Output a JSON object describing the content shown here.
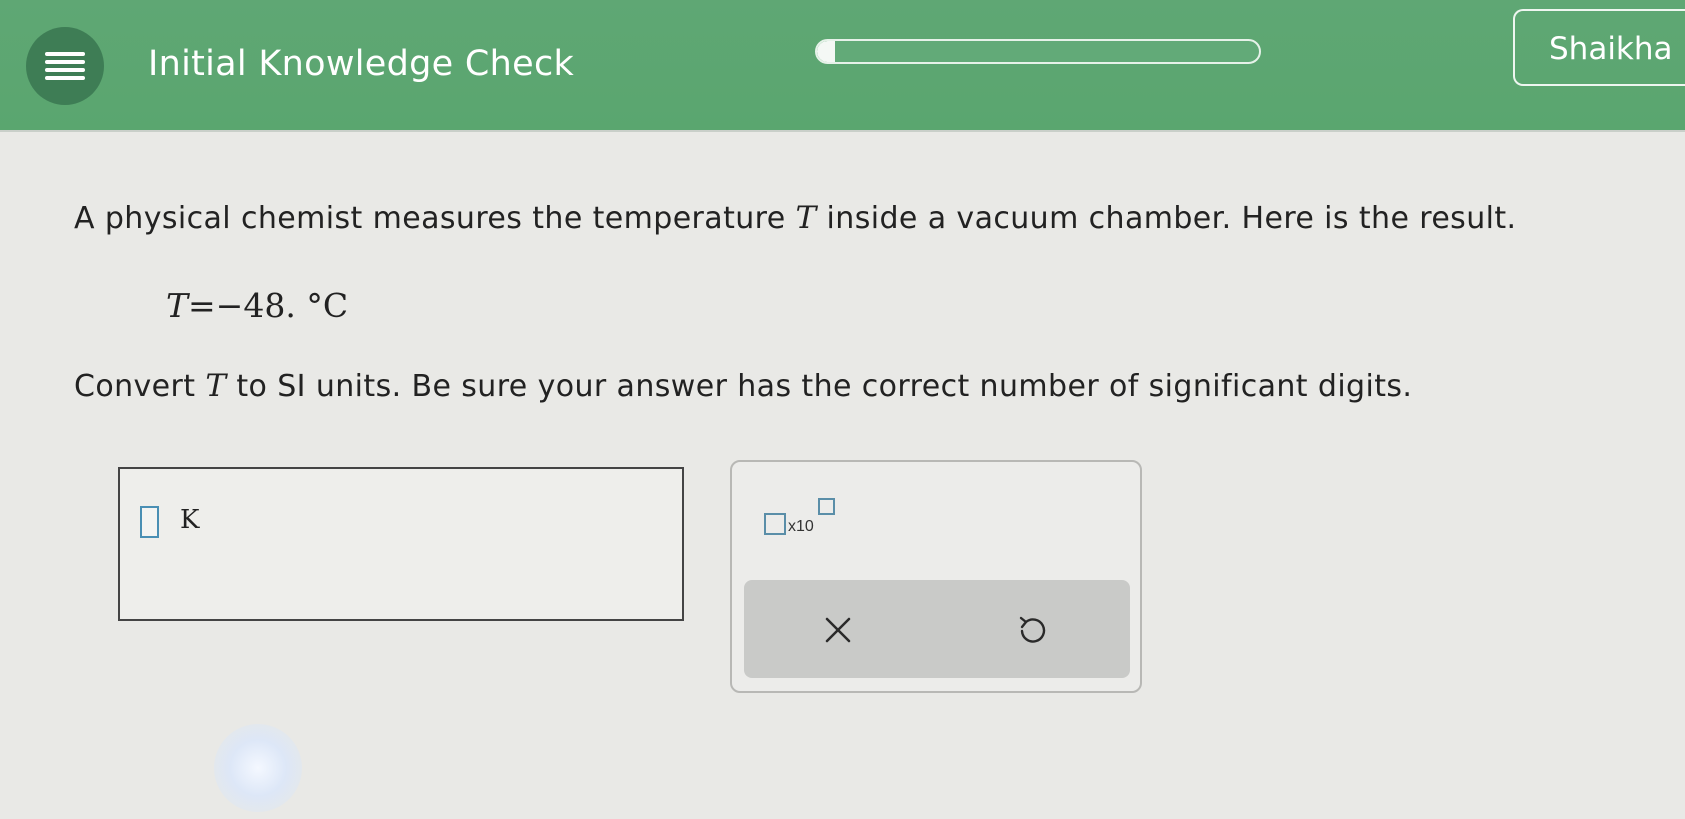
{
  "header": {
    "title": "Initial Knowledge Check",
    "progress_fraction": 0.04,
    "user_name": "Shaikha",
    "menu_icon": "hamburger-icon",
    "colors": {
      "bar": "#5aa66f",
      "menu_button": "#3e7d55"
    }
  },
  "question": {
    "intro_part1": "A physical chemist measures the temperature ",
    "variable": "T",
    "intro_part2": " inside a vacuum chamber. Here is the result.",
    "equation": {
      "lhs": "T",
      "equals": "=",
      "value": "−48.",
      "unit": "°C"
    },
    "instruction_part1": "Convert ",
    "instruction_part2": " to SI units. Be sure your answer has the correct number of significant digits."
  },
  "answer": {
    "value": "",
    "unit": "K"
  },
  "keypad": {
    "sci_notation_label": "x10",
    "clear_icon": "close-icon",
    "undo_icon": "undo-icon"
  }
}
